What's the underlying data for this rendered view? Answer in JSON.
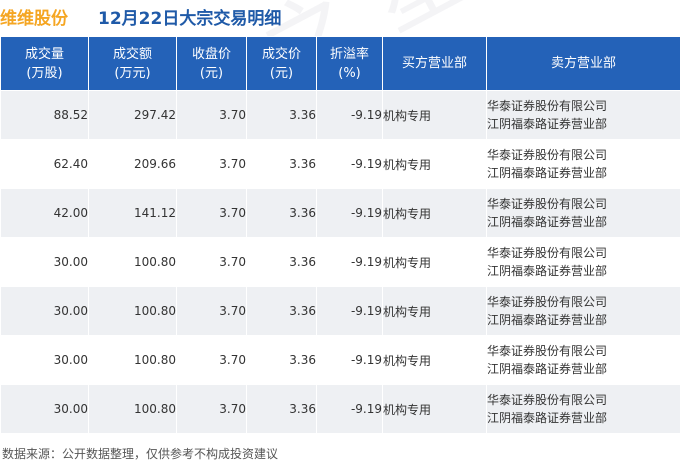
{
  "title": {
    "stock": "维维股份",
    "main": "12月22日大宗交易明细"
  },
  "table": {
    "headers": [
      [
        "成交量",
        "(万股)"
      ],
      [
        "成交额",
        "(万元)"
      ],
      [
        "收盘价",
        "(元)"
      ],
      [
        "成交价",
        "(元)"
      ],
      [
        "折溢率",
        "(%)"
      ],
      [
        "买方营业部"
      ],
      [
        "卖方营业部"
      ]
    ],
    "rows": [
      {
        "volume": "88.52",
        "amount": "297.42",
        "close": "3.70",
        "price": "3.36",
        "rate": "-9.19",
        "buyer": "机构专用",
        "seller1": "华泰证券股份有限公司",
        "seller2": "江阴福泰路证券营业部"
      },
      {
        "volume": "62.40",
        "amount": "209.66",
        "close": "3.70",
        "price": "3.36",
        "rate": "-9.19",
        "buyer": "机构专用",
        "seller1": "华泰证券股份有限公司",
        "seller2": "江阴福泰路证券营业部"
      },
      {
        "volume": "42.00",
        "amount": "141.12",
        "close": "3.70",
        "price": "3.36",
        "rate": "-9.19",
        "buyer": "机构专用",
        "seller1": "华泰证券股份有限公司",
        "seller2": "江阴福泰路证券营业部"
      },
      {
        "volume": "30.00",
        "amount": "100.80",
        "close": "3.70",
        "price": "3.36",
        "rate": "-9.19",
        "buyer": "机构专用",
        "seller1": "华泰证券股份有限公司",
        "seller2": "江阴福泰路证券营业部"
      },
      {
        "volume": "30.00",
        "amount": "100.80",
        "close": "3.70",
        "price": "3.36",
        "rate": "-9.19",
        "buyer": "机构专用",
        "seller1": "华泰证券股份有限公司",
        "seller2": "江阴福泰路证券营业部"
      },
      {
        "volume": "30.00",
        "amount": "100.80",
        "close": "3.70",
        "price": "3.36",
        "rate": "-9.19",
        "buyer": "机构专用",
        "seller1": "华泰证券股份有限公司",
        "seller2": "江阴福泰路证券营业部"
      },
      {
        "volume": "30.00",
        "amount": "100.80",
        "close": "3.70",
        "price": "3.36",
        "rate": "-9.19",
        "buyer": "机构专用",
        "seller1": "华泰证券股份有限公司",
        "seller2": "江阴福泰路证券营业部"
      }
    ]
  },
  "footer": "数据来源：公开数据整理，仅供参考不构成投资建议",
  "watermark": "证券之星",
  "colors": {
    "header_bg": "#2462b8",
    "stock_title": "#f5a623",
    "main_title": "#1f5aa8",
    "negative": "#2e9e2e",
    "row_alt": "#eef0f3"
  }
}
